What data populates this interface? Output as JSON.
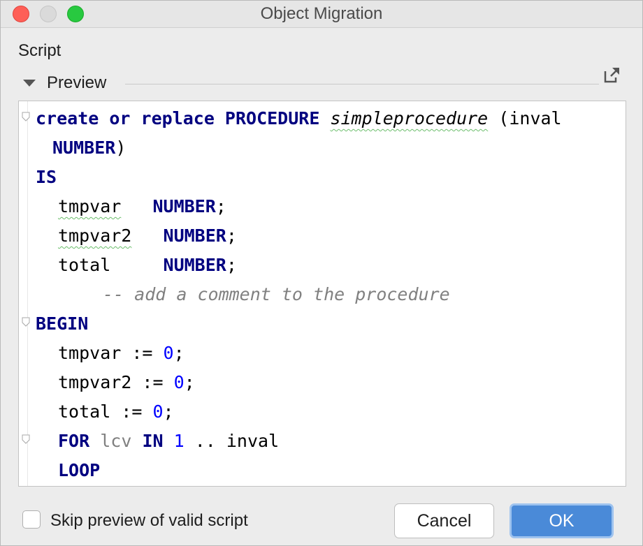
{
  "window": {
    "title": "Object Migration"
  },
  "section": {
    "label": "Script"
  },
  "preview": {
    "label": "Preview",
    "open_icon": "open-in-window-icon"
  },
  "code": {
    "l1_kw": "create or replace PROCEDURE",
    "l1_fn": "simpleprocedure",
    "l1_rest": " (inval",
    "l2_kw": "NUMBER",
    "l2_rest": ")",
    "l3_kw": "IS",
    "l4_var": "tmpvar",
    "l4_kw": "NUMBER",
    "l4_rest": ";",
    "l5_var": "tmpvar2",
    "l5_kw": "NUMBER",
    "l5_rest": ";",
    "l6_var": "total",
    "l6_kw": "NUMBER",
    "l6_rest": ";",
    "l7_comment": "-- add a comment to the procedure",
    "l8_kw": "BEGIN",
    "l9_text": "tmpvar := ",
    "l9_num": "0",
    "l9_rest": ";",
    "l10_text": "tmpvar2 := ",
    "l10_num": "0",
    "l10_rest": ";",
    "l11_text": "total := ",
    "l11_num": "0",
    "l11_rest": ";",
    "l12_kw1": "FOR",
    "l12_var": "lcv",
    "l12_kw2": "IN",
    "l12_num": "1",
    "l12_rest": " .. inval",
    "l13_kw": "LOOP"
  },
  "footer": {
    "skip_label": "Skip preview of valid script",
    "cancel_label": "Cancel",
    "ok_label": "OK"
  },
  "colors": {
    "keyword": "#000080",
    "number": "#0000ff",
    "comment": "#808080",
    "ok_button": "#4a8ad8"
  }
}
